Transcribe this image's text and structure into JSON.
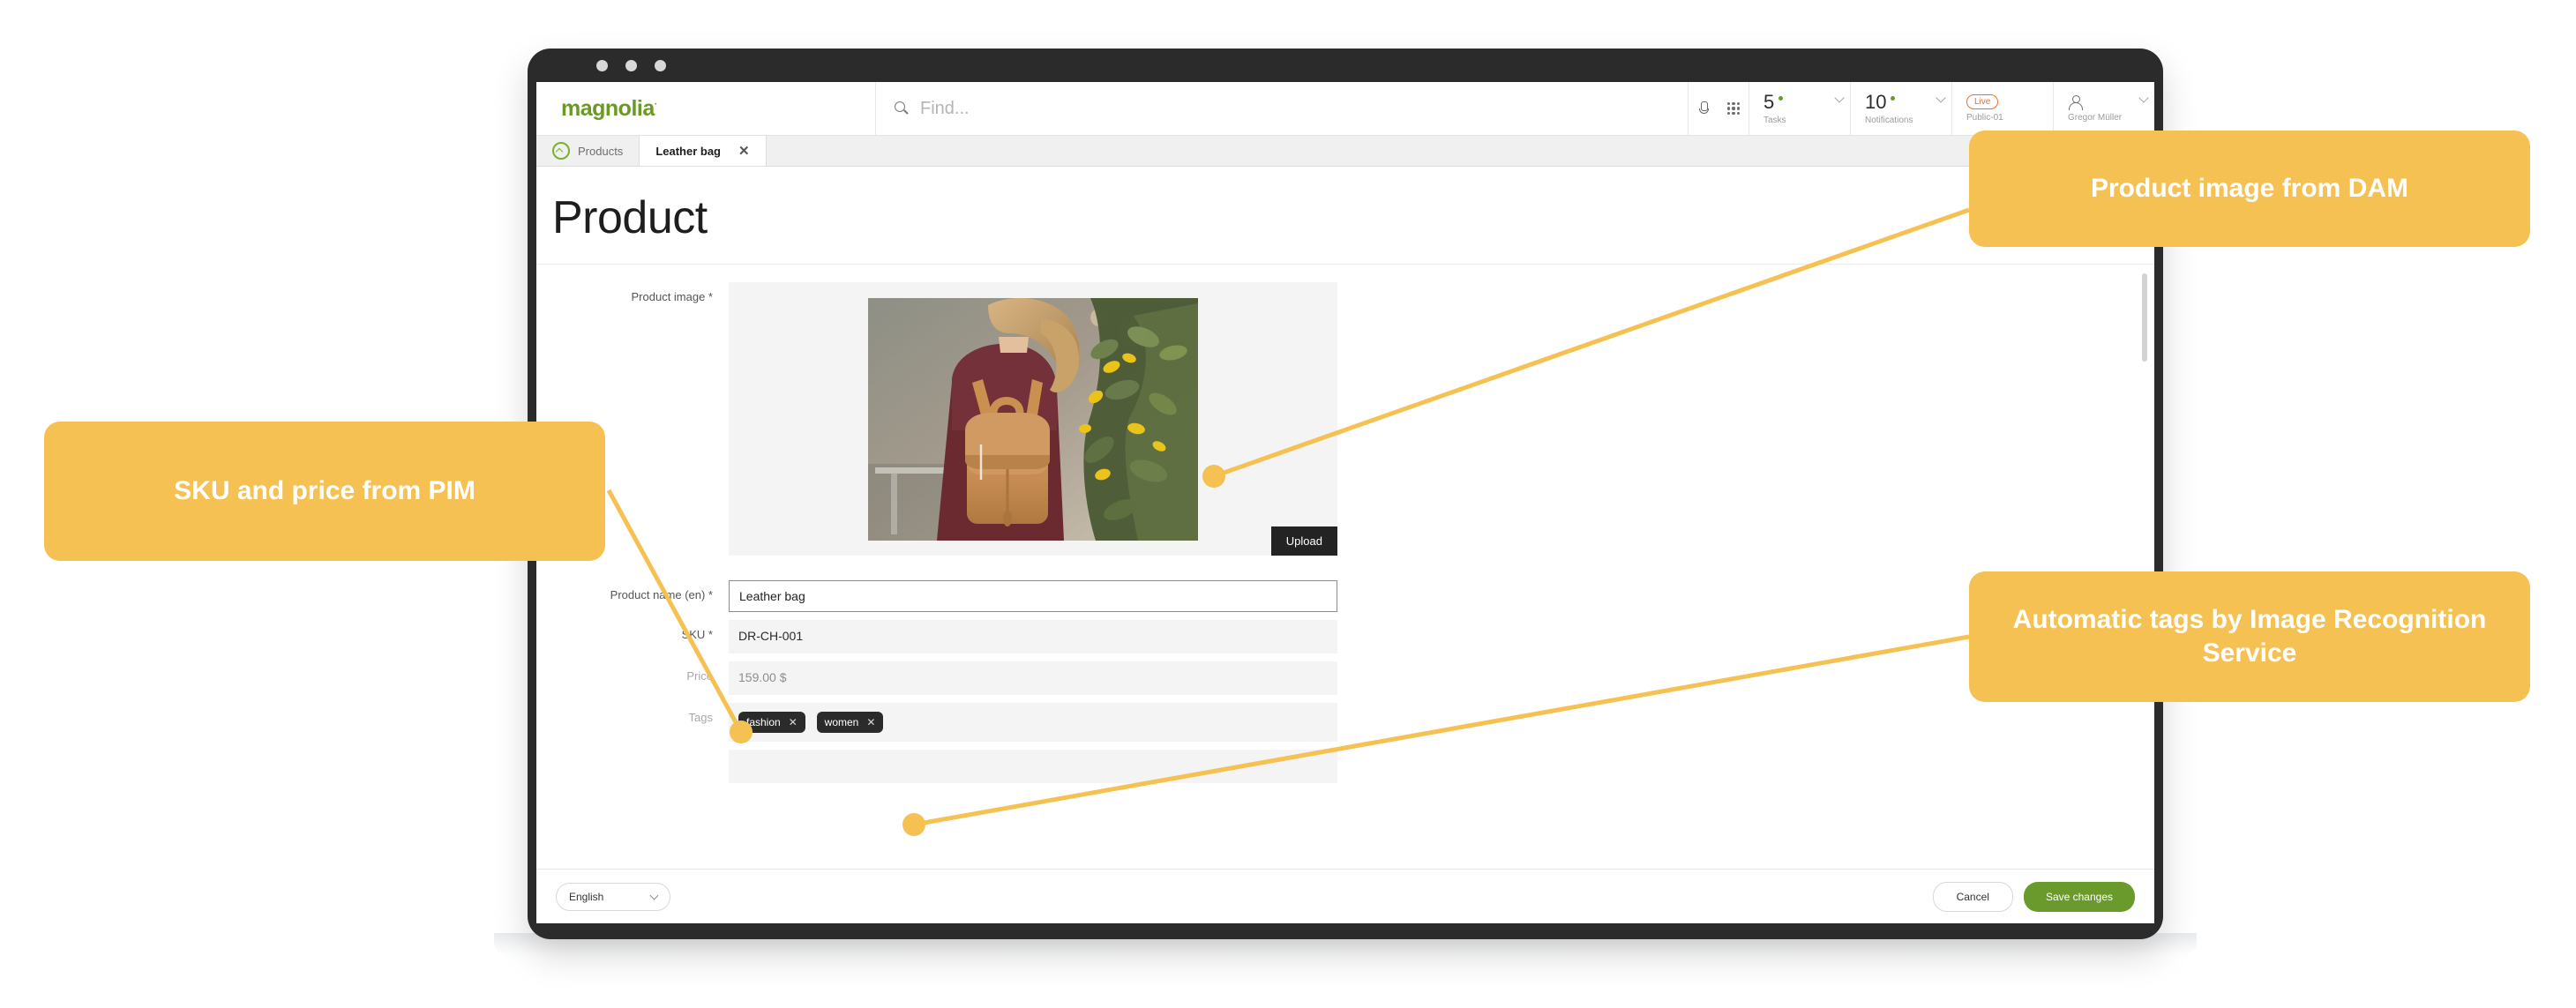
{
  "window": {
    "dots_count": 3
  },
  "topbar": {
    "logo": "magnolia",
    "logo_sup": "·",
    "search_placeholder": "Find...",
    "mic_icon": "microphone-icon",
    "apps_icon": "app-grid-icon",
    "tasks": {
      "count": "5",
      "label": "Tasks"
    },
    "notifications": {
      "count": "10",
      "label": "Notifications"
    },
    "instance": {
      "badge": "Live",
      "label": "Public-01"
    },
    "user": {
      "name": "Gregor Müller",
      "icon": "user-avatar-icon"
    }
  },
  "tabs": [
    {
      "label": "Products",
      "active": false,
      "icon": "magnolia-circle-icon"
    },
    {
      "label": "Leather bag",
      "active": true,
      "close": "✕"
    }
  ],
  "page": {
    "title": "Product"
  },
  "form": {
    "image": {
      "label": "Product image *",
      "upload_label": "Upload",
      "alt": "woman wearing tan leather backpack beside yellow flowers"
    },
    "fields": [
      {
        "label": "Product name (en) *",
        "value": "Leather bag",
        "type": "text-active"
      },
      {
        "label": "SKU *",
        "value": "DR-CH-001",
        "type": "readonly"
      },
      {
        "label": "Price",
        "value": "159.00  $",
        "type": "readonly-grey"
      },
      {
        "label": "Tags",
        "value": "",
        "type": "tags"
      }
    ],
    "tags": [
      {
        "label": "fashion",
        "remove": "✕"
      },
      {
        "label": "women",
        "remove": "✕"
      }
    ]
  },
  "footer": {
    "language": "English",
    "cancel_label": "Cancel",
    "save_label": "Save changes"
  },
  "callouts": [
    {
      "id": "dam",
      "text": "Product image from DAM"
    },
    {
      "id": "pim",
      "text": "SKU and price from PIM"
    },
    {
      "id": "tags",
      "text": "Automatic tags by Image Recognition Service"
    }
  ],
  "colors": {
    "callout_bg": "#f5c152",
    "connector": "#f5c152",
    "brand_green": "#6a9a24",
    "save_green": "#6a9a2c",
    "live_orange": "#e8702a",
    "chip_dark": "#2b2b2b"
  }
}
